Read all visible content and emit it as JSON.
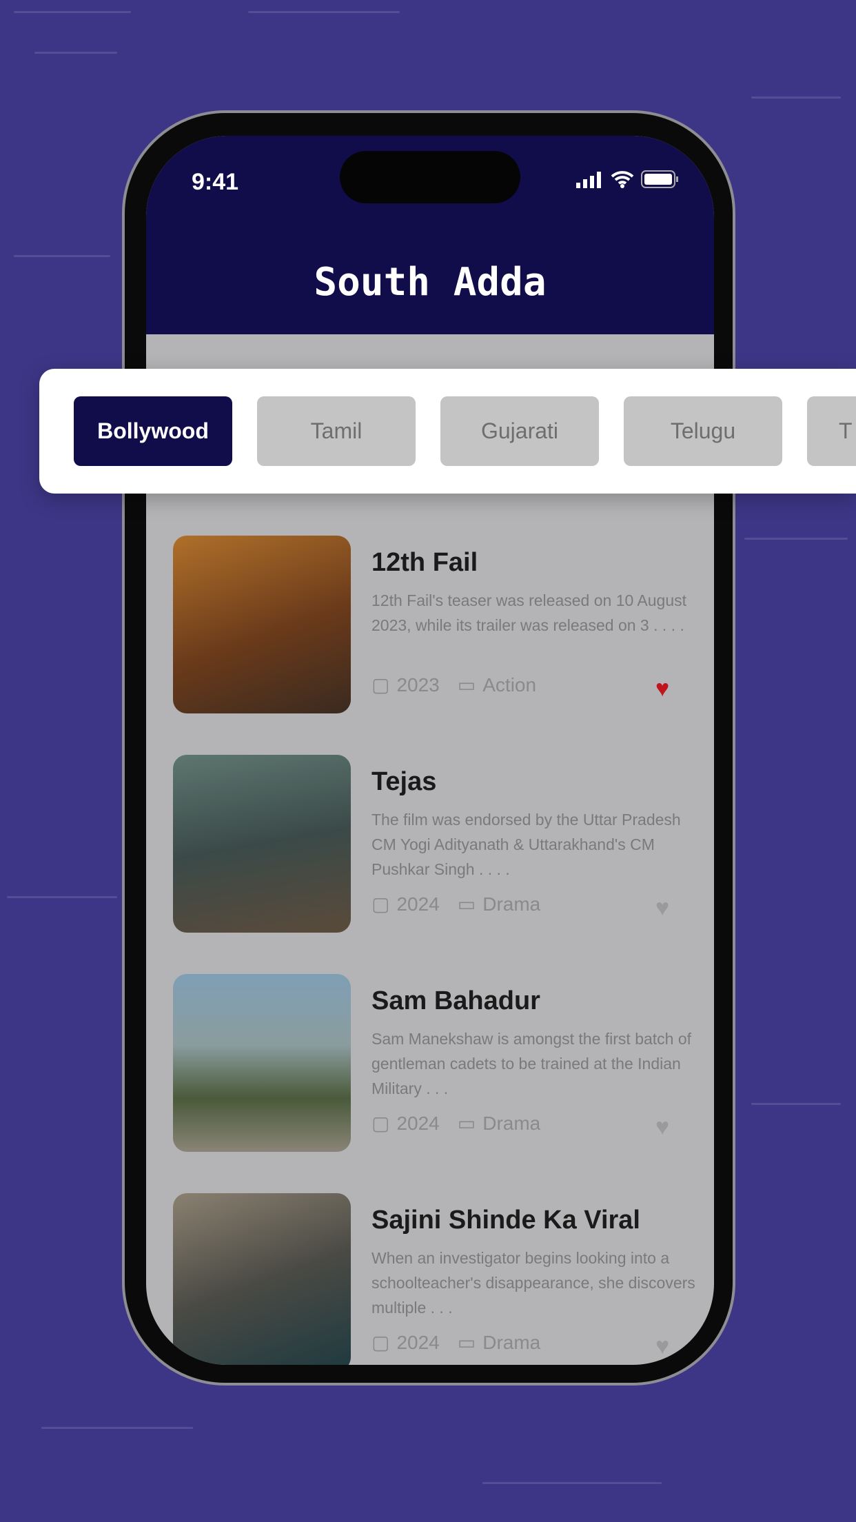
{
  "status_bar": {
    "time": "9:41"
  },
  "app": {
    "title": "South Adda"
  },
  "categories": [
    {
      "label": "Bollywood",
      "active": true
    },
    {
      "label": "Tamil",
      "active": false
    },
    {
      "label": "Gujarati",
      "active": false
    },
    {
      "label": "Telugu",
      "active": false
    },
    {
      "label": "T",
      "active": false
    }
  ],
  "movies": [
    {
      "title": "12th Fail",
      "description": "12th Fail's teaser was released on 10 August 2023, while its trailer was released on 3 . . . .",
      "year": "2023",
      "genre": "Action",
      "favorite": true
    },
    {
      "title": "Tejas",
      "description": "The film was endorsed by the Uttar Pradesh CM Yogi Adityanath & Uttarakhand's CM Pushkar Singh . . . .",
      "year": "2024",
      "genre": "Drama",
      "favorite": false
    },
    {
      "title": "Sam Bahadur",
      "description": "Sam Manekshaw is amongst the first batch of gentleman cadets to be trained at the Indian Military . . .",
      "year": "2024",
      "genre": "Drama",
      "favorite": false
    },
    {
      "title": "Sajini Shinde Ka Viral",
      "description": "When an investigator begins looking into a schoolteacher's disappearance, she discovers multiple . . .",
      "year": "2024",
      "genre": "Drama",
      "favorite": false
    }
  ],
  "colors": {
    "background": "#3d3686",
    "header": "#110c4a",
    "favorite": "#c0151b",
    "unfavorite": "#9a9a9a"
  }
}
